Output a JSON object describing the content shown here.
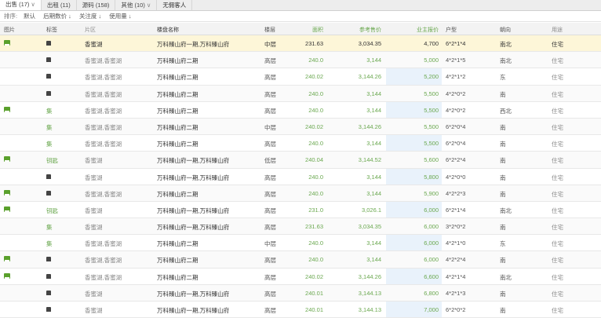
{
  "tabs": [
    {
      "label": "出售 (17)",
      "x": "∨"
    },
    {
      "label": "出租 (11)"
    },
    {
      "label": "源码 (158)"
    },
    {
      "label": "其他 (10)",
      "x": "∨"
    },
    {
      "label": "无佣客人"
    }
  ],
  "sortbar": {
    "label": "排序:",
    "options": [
      "默认",
      "后期数价 ↓",
      "关注度 ↓",
      "使用量 ↓"
    ]
  },
  "headers": {
    "img": "图片",
    "tag": "标签",
    "area": "片区",
    "name": "楼盘名称",
    "floor": "楼层",
    "size": "面积",
    "ref": "参考售价",
    "price": "业主报价",
    "type": "户型",
    "dir": "朝向",
    "use": "用途"
  },
  "rows": [
    {
      "img": true,
      "tag": "▲",
      "area": "香蜜湖",
      "name": "万科臻山府一期,万科臻山府",
      "floor": "中层",
      "size": "231.63",
      "ref": "3,034.35",
      "price": "4,700",
      "type": "6*2*1*4",
      "dir": "南北",
      "use": "住宅",
      "hl": true
    },
    {
      "img": false,
      "tag": "■",
      "area": "香蜜湖,香蜜湖",
      "name": "万科臻山府二期",
      "floor": "高层",
      "size": "240.0",
      "ref": "3,144",
      "price": "5,000",
      "type": "4*2*1*5",
      "dir": "南北",
      "use": "住宅"
    },
    {
      "img": false,
      "tag": "■",
      "area": "香蜜湖,香蜜湖",
      "name": "万科臻山府二期",
      "floor": "高层",
      "size": "240.02",
      "ref": "3,144.26",
      "price": "5,200",
      "type": "4*2*1*2",
      "dir": "东",
      "use": "住宅"
    },
    {
      "img": false,
      "tag": "■",
      "area": "香蜜湖,香蜜湖",
      "name": "万科臻山府二期",
      "floor": "高层",
      "size": "240.0",
      "ref": "3,144",
      "price": "5,500",
      "type": "4*2*0*2",
      "dir": "南",
      "use": "住宅"
    },
    {
      "img": true,
      "tag": "集",
      "area": "香蜜湖,香蜜湖",
      "name": "万科臻山府二期",
      "floor": "高层",
      "size": "240.0",
      "ref": "3,144",
      "price": "5,500",
      "type": "4*2*0*2",
      "dir": "西北",
      "use": "住宅"
    },
    {
      "img": false,
      "tag": "集",
      "area": "香蜜湖,香蜜湖",
      "name": "万科臻山府二期",
      "floor": "中层",
      "size": "240.02",
      "ref": "3,144.26",
      "price": "5,500",
      "type": "6*2*0*4",
      "dir": "南",
      "use": "住宅"
    },
    {
      "img": false,
      "tag": "集",
      "area": "香蜜湖,香蜜湖",
      "name": "万科臻山府二期",
      "floor": "高层",
      "size": "240.0",
      "ref": "3,144",
      "price": "5,500",
      "type": "6*2*0*4",
      "dir": "南",
      "use": "住宅"
    },
    {
      "img": true,
      "tag": "钥匙",
      "area": "香蜜湖",
      "name": "万科臻山府一期,万科臻山府",
      "floor": "低层",
      "size": "240.04",
      "ref": "3,144.52",
      "price": "5,600",
      "type": "6*2*2*4",
      "dir": "南",
      "use": "住宅"
    },
    {
      "img": false,
      "tag": "■",
      "area": "香蜜湖",
      "name": "万科臻山府一期,万科臻山府",
      "floor": "高层",
      "size": "240.0",
      "ref": "3,144",
      "price": "5,800",
      "type": "4*2*0*0",
      "dir": "南",
      "use": "住宅"
    },
    {
      "img": true,
      "tag": "■",
      "area": "香蜜湖,香蜜湖",
      "name": "万科臻山府二期",
      "floor": "高层",
      "size": "240.0",
      "ref": "3,144",
      "price": "5,900",
      "type": "4*2*2*3",
      "dir": "南",
      "use": "住宅"
    },
    {
      "img": true,
      "tag": "钥匙",
      "area": "香蜜湖",
      "name": "万科臻山府一期,万科臻山府",
      "floor": "高层",
      "size": "231.0",
      "ref": "3,026.1",
      "price": "6,000",
      "type": "6*2*1*4",
      "dir": "南北",
      "use": "住宅"
    },
    {
      "img": false,
      "tag": "集",
      "area": "香蜜湖",
      "name": "万科臻山府一期,万科臻山府",
      "floor": "高层",
      "size": "231.63",
      "ref": "3,034.35",
      "price": "6,000",
      "type": "3*2*0*2",
      "dir": "南",
      "use": "住宅"
    },
    {
      "img": false,
      "tag": "集",
      "area": "香蜜湖,香蜜湖",
      "name": "万科臻山府二期",
      "floor": "中层",
      "size": "240.0",
      "ref": "3,144",
      "price": "6,000",
      "type": "4*2*1*0",
      "dir": "东",
      "use": "住宅"
    },
    {
      "img": true,
      "tag": "▲",
      "area": "香蜜湖,香蜜湖",
      "name": "万科臻山府二期",
      "floor": "高层",
      "size": "240.0",
      "ref": "3,144",
      "price": "6,000",
      "type": "4*2*2*4",
      "dir": "南",
      "use": "住宅"
    },
    {
      "img": true,
      "tag": "■",
      "area": "香蜜湖,香蜜湖",
      "name": "万科臻山府二期",
      "floor": "高层",
      "size": "240.02",
      "ref": "3,144.26",
      "price": "6,600",
      "type": "4*2*1*4",
      "dir": "南北",
      "use": "住宅"
    },
    {
      "img": false,
      "tag": "■",
      "area": "香蜜湖",
      "name": "万科臻山府一期,万科臻山府",
      "floor": "高层",
      "size": "240.01",
      "ref": "3,144.13",
      "price": "6,800",
      "type": "4*2*1*3",
      "dir": "南",
      "use": "住宅"
    },
    {
      "img": false,
      "tag": "■",
      "area": "香蜜湖",
      "name": "万科臻山府一期,万科臻山府",
      "floor": "高层",
      "size": "240.01",
      "ref": "3,144.13",
      "price": "7,000",
      "type": "6*2*0*2",
      "dir": "南",
      "use": "住宅"
    }
  ]
}
